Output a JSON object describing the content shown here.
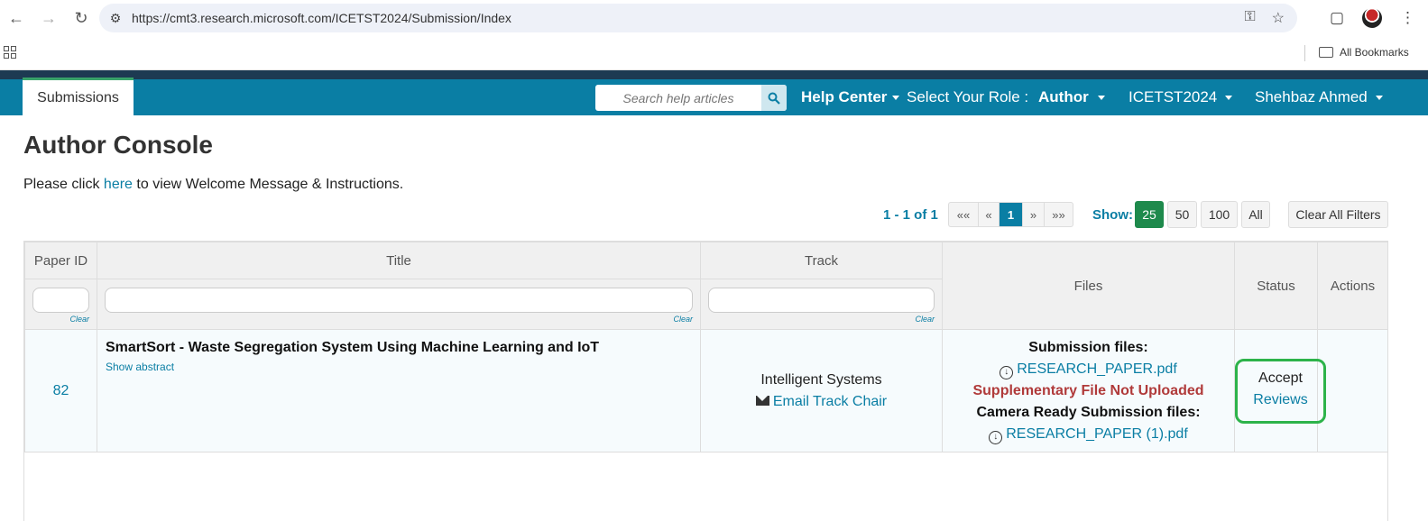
{
  "browser": {
    "url": "https://cmt3.research.microsoft.com/ICETST2024/Submission/Index",
    "bookmarks_label": "All Bookmarks"
  },
  "nav": {
    "active_tab": "Submissions",
    "search_placeholder": "Search help articles",
    "help_center": "Help Center",
    "role_label": "Select Your Role :",
    "role_value": "Author",
    "conference": "ICETST2024",
    "user": "Shehbaz Ahmed"
  },
  "page": {
    "title": "Author Console",
    "welcome_prefix": "Please click ",
    "welcome_link": "here",
    "welcome_suffix": " to view Welcome Message & Instructions."
  },
  "pager": {
    "count": "1 - 1 of 1",
    "first": "««",
    "prev": "«",
    "current": "1",
    "next": "»",
    "last": "»»",
    "show_label": "Show:",
    "sizes": [
      "25",
      "50",
      "100",
      "All"
    ],
    "active_size": "25",
    "clear_all": "Clear All Filters"
  },
  "table": {
    "headers": {
      "paper_id": "Paper ID",
      "title": "Title",
      "track": "Track",
      "files": "Files",
      "status": "Status",
      "actions": "Actions"
    },
    "clear_label": "Clear",
    "rows": [
      {
        "paper_id": "82",
        "title": "SmartSort - Waste Segregation System Using Machine Learning and IoT",
        "show_abstract": "Show abstract",
        "track": "Intelligent Systems",
        "email_track_chair": "Email Track Chair",
        "submission_files_label": "Submission files:",
        "submission_file": "RESEARCH_PAPER.pdf",
        "supplementary_notice": "Supplementary File Not Uploaded",
        "camera_ready_label": "Camera Ready Submission files:",
        "camera_ready_file": "RESEARCH_PAPER (1).pdf",
        "status": "Accept",
        "reviews": "Reviews"
      }
    ]
  }
}
